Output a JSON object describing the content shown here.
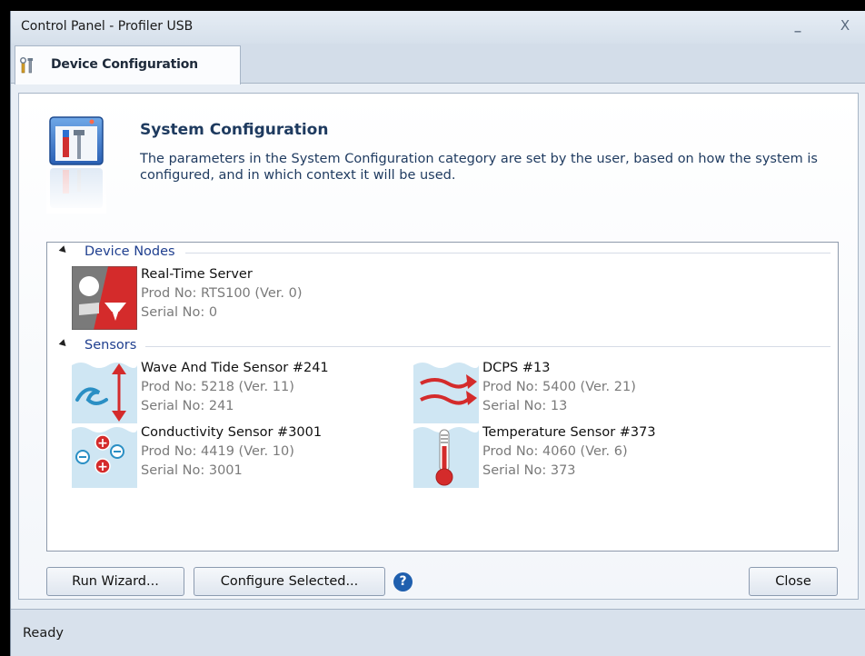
{
  "window": {
    "title": "Control Panel - Profiler USB",
    "minimize_glyph": "_",
    "close_glyph": "X"
  },
  "tab": {
    "label": "Device Configuration",
    "icon": "tools-icon"
  },
  "system": {
    "title": "System Configuration",
    "description": "The parameters in the System Configuration category are set by the user, based on how the system is configured, and in which context it will be used.",
    "icon": "window-tools-icon"
  },
  "groups": [
    {
      "label": "Device Nodes",
      "items": [
        {
          "name": "Real-Time Server",
          "prod": "Prod No: RTS100 (Ver. 0)",
          "serial": "Serial No: 0",
          "icon": "real-time-server-icon"
        }
      ]
    },
    {
      "label": "Sensors",
      "items": [
        {
          "name": "Wave And Tide Sensor #241",
          "prod": "Prod No: 5218 (Ver. 11)",
          "serial": "Serial No: 241",
          "icon": "wave-tide-sensor-icon"
        },
        {
          "name": "DCPS #13",
          "prod": "Prod No: 5400 (Ver. 21)",
          "serial": "Serial No: 13",
          "icon": "current-sensor-icon"
        },
        {
          "name": "Conductivity Sensor #3001",
          "prod": "Prod No: 4419 (Ver. 10)",
          "serial": "Serial No: 3001",
          "icon": "conductivity-sensor-icon"
        },
        {
          "name": "Temperature Sensor #373",
          "prod": "Prod No: 4060 (Ver. 6)",
          "serial": "Serial No: 373",
          "icon": "thermometer-icon"
        }
      ]
    }
  ],
  "buttons": {
    "run_wizard": "Run Wizard...",
    "configure_selected": "Configure Selected...",
    "help": "?",
    "close": "Close"
  },
  "status": "Ready"
}
